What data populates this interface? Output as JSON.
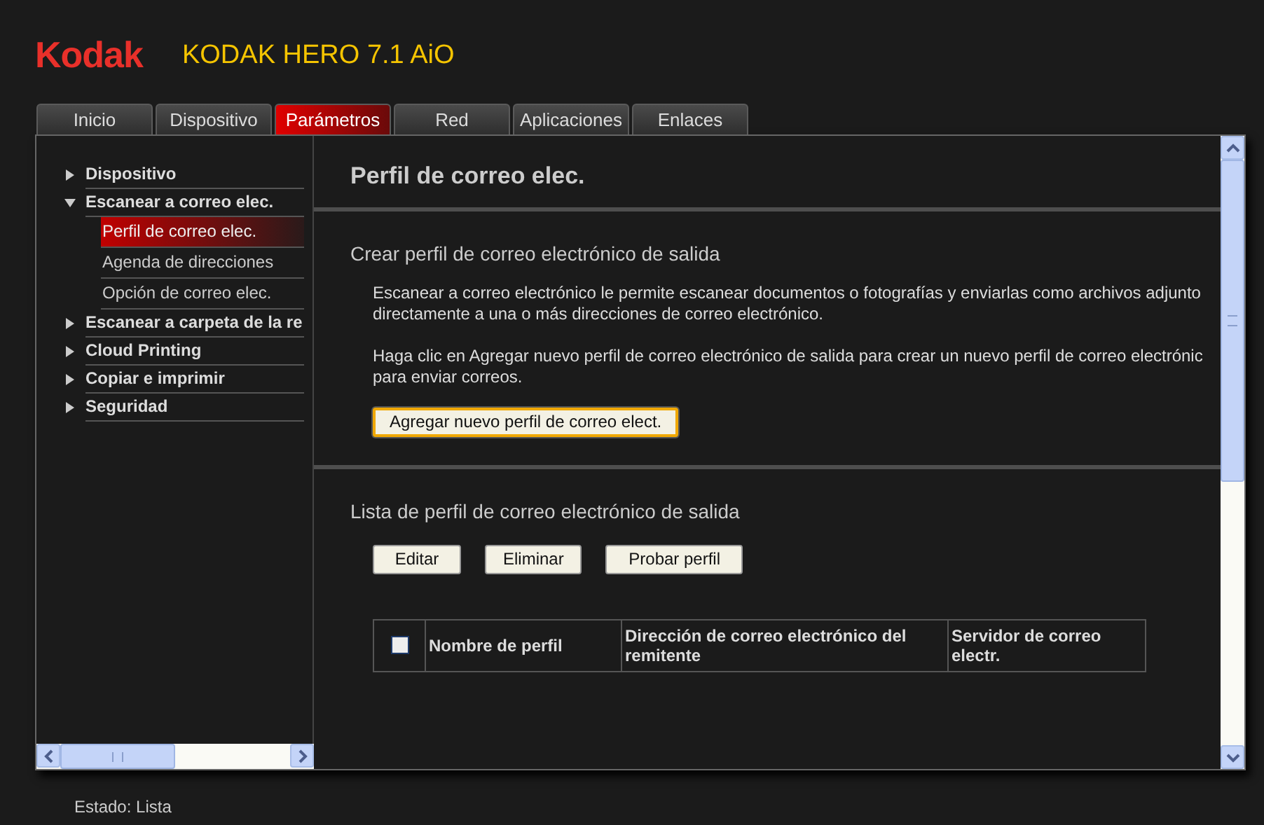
{
  "logo": "Kodak",
  "title": "KODAK HERO 7.1 AiO",
  "tabs": [
    {
      "label": "Inicio",
      "selected": false
    },
    {
      "label": "Dispositivo",
      "selected": false
    },
    {
      "label": "Parámetros",
      "selected": true
    },
    {
      "label": "Red",
      "selected": false
    },
    {
      "label": "Aplicaciones",
      "selected": false
    },
    {
      "label": "Enlaces",
      "selected": false
    }
  ],
  "sidebar": {
    "items": [
      {
        "label": "Dispositivo",
        "expanded": false
      },
      {
        "label": "Escanear a correo elec.",
        "expanded": true,
        "children": [
          {
            "label": "Perfil de correo elec.",
            "selected": true
          },
          {
            "label": "Agenda de direcciones",
            "selected": false
          },
          {
            "label": "Opción de correo elec.",
            "selected": false
          }
        ]
      },
      {
        "label": "Escanear a carpeta de la re",
        "expanded": false
      },
      {
        "label": "Cloud Printing",
        "expanded": false
      },
      {
        "label": "Copiar e imprimir",
        "expanded": false
      },
      {
        "label": "Seguridad",
        "expanded": false
      }
    ]
  },
  "content": {
    "heading": "Perfil de correo elec.",
    "create_section": {
      "title": "Crear perfil de correo electrónico de salida",
      "paragraphs": [
        [
          "Escanear a correo electrónico le permite escanear documentos o fotografías y enviarlas como archivos adjunto",
          "directamente a una o más direcciones de correo electrónico."
        ],
        [
          "Haga clic en Agregar nuevo perfil de correo electrónico de salida para crear un nuevo perfil de correo electrónic",
          "para enviar correos."
        ]
      ],
      "button": "Agregar nuevo perfil de correo elect."
    },
    "list_section": {
      "title": "Lista de perfil de correo electrónico de salida",
      "buttons": [
        "Editar",
        "Eliminar",
        "Probar perfil"
      ],
      "table": {
        "select_all_checked": false,
        "columns": [
          "Nombre de perfil",
          "Dirección de correo electrónico del remitente",
          "Servidor de correo electr."
        ]
      }
    }
  },
  "status": "Estado: Lista"
}
